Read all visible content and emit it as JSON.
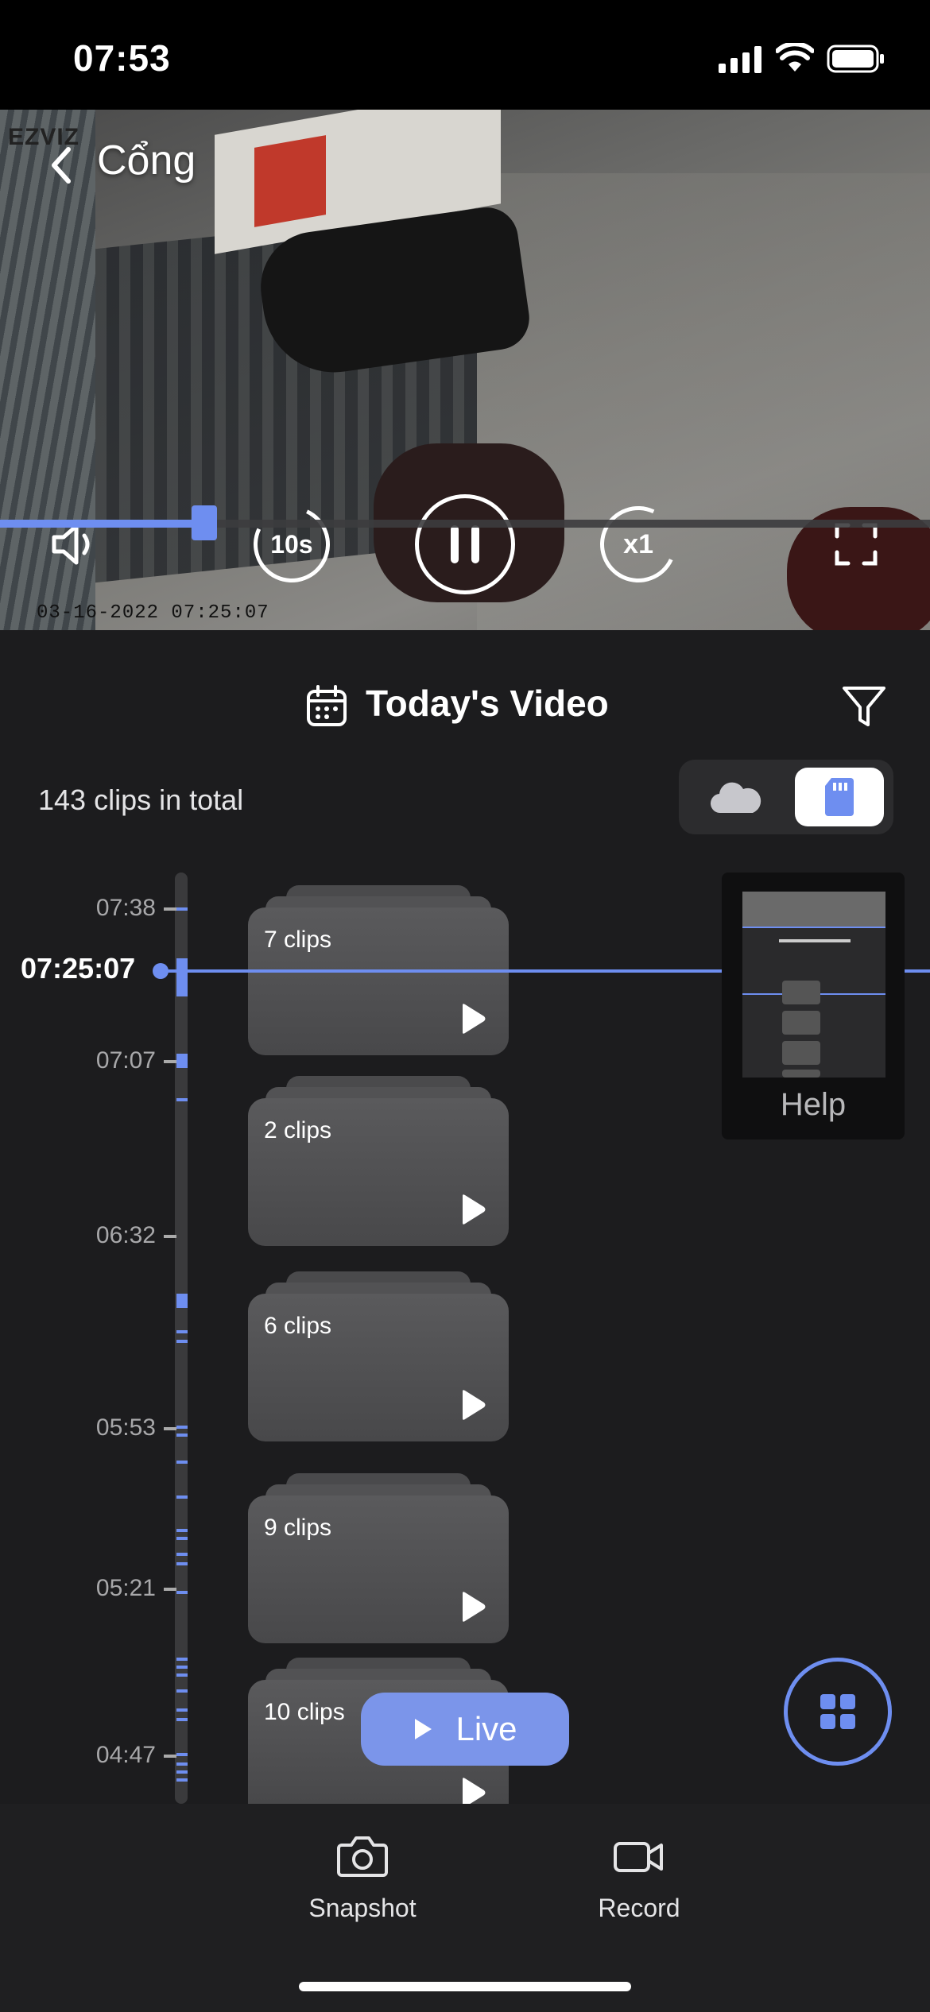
{
  "status_bar": {
    "time": "07:53"
  },
  "player": {
    "brand": "EZVIZ",
    "camera_name": "Cổng",
    "timestamp": "03-16-2022 07:25:07",
    "controls": {
      "rewind_label": "10s",
      "speed_label": "x1"
    },
    "progress_fraction": 0.22
  },
  "header": {
    "title": "Today's Video",
    "clips_total": "143 clips in total",
    "storage_selected": "sd-card"
  },
  "timeline": {
    "current_time": "07:25:07",
    "labels": [
      "07:38",
      "07:07",
      "06:32",
      "05:53",
      "05:21",
      "04:47"
    ]
  },
  "clip_groups": [
    {
      "label": "7 clips"
    },
    {
      "label": "2 clips"
    },
    {
      "label": "6 clips"
    },
    {
      "label": "9 clips"
    },
    {
      "label": "10 clips"
    }
  ],
  "help": {
    "label": "Help"
  },
  "live_button": {
    "label": "Live"
  },
  "toolbar": {
    "snapshot_label": "Snapshot",
    "record_label": "Record"
  },
  "colors": {
    "accent": "#6e8ef0",
    "background": "#1c1c1e"
  }
}
